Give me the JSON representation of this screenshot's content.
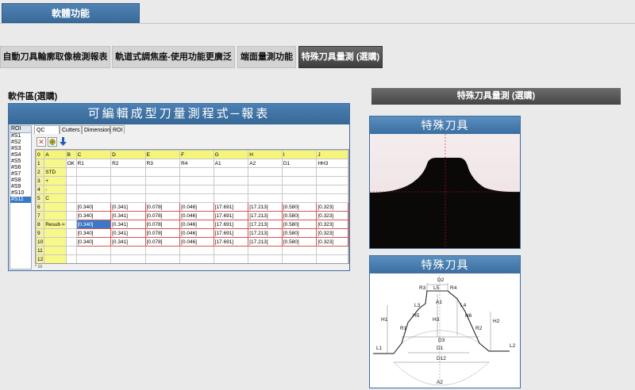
{
  "header": {
    "title": "軟體功能"
  },
  "feature_tabs": [
    {
      "label": "自動刀具輪廓取像檢測報表"
    },
    {
      "label": "軌道式調焦座-使用功能更廣泛"
    },
    {
      "label": "端面量測功能"
    },
    {
      "label": "特殊刀具量測 (選購)"
    }
  ],
  "software_section": {
    "label": "軟件區(選購)"
  },
  "app_window": {
    "title": "可編輯成型刀量測程式─報表",
    "roi_list": {
      "header": "ROI",
      "items": [
        "#S1",
        "#S2",
        "#S3",
        "#S4",
        "#S5",
        "#S6",
        "#S7",
        "#S8",
        "#S9",
        "#S10",
        "#S11"
      ],
      "selected": "#S11"
    },
    "subtabs": [
      "QC",
      "Cutters",
      "Dimension",
      "ROI"
    ],
    "toolbar": {
      "icons": [
        "close-icon",
        "refresh-icon",
        "download-arrow-icon"
      ]
    },
    "sheet": {
      "col_headers": [
        "0",
        "A",
        "B",
        "C",
        "D",
        "E",
        "F",
        "G",
        "H",
        "I",
        "J"
      ],
      "rows": [
        [
          "1",
          "",
          "OK",
          "R1",
          "R2",
          "R3",
          "R4",
          "A1",
          "A2",
          "D1",
          "HH3"
        ],
        [
          "2",
          "STD",
          "",
          "",
          "",
          "",
          "",
          "",
          "",
          "",
          ""
        ],
        [
          "3",
          "+",
          "",
          "",
          "",
          "",
          "",
          "",
          "",
          "",
          ""
        ],
        [
          "4",
          "-",
          "",
          "",
          "",
          "",
          "",
          "",
          "",
          "",
          ""
        ],
        [
          "5",
          "C",
          "",
          "",
          "",
          "",
          "",
          "",
          "",
          "",
          ""
        ],
        [
          "6",
          "",
          "",
          "[0.340]",
          "[0.341]",
          "[0.078]",
          "[0.046]",
          "[17.691]",
          "[17.213]",
          "[0.580]",
          "[0.323]"
        ],
        [
          "7",
          "",
          "",
          "[0.340]",
          "[0.341]",
          "[0.078]",
          "[0.046]",
          "[17.691]",
          "[17.213]",
          "[0.580]",
          "[0.323]"
        ],
        [
          "8",
          "Result->",
          "",
          "[0.340]",
          "[0.341]",
          "[0.078]",
          "[0.046]",
          "[17.691]",
          "[17.213]",
          "[0.580]",
          "[0.323]"
        ],
        [
          "9",
          "",
          "",
          "[0.340]",
          "[0.341]",
          "[0.078]",
          "[0.046]",
          "[17.691]",
          "[17.213]",
          "[0.580]",
          "[0.323]"
        ],
        [
          "10",
          "",
          "",
          "[0.340]",
          "[0.341]",
          "[0.078]",
          "[0.046]",
          "[17.691]",
          "[17.213]",
          "[0.580]",
          "[0.323]"
        ],
        [
          "11",
          "",
          "",
          "",
          "",
          "",
          "",
          "",
          "",
          "",
          ""
        ],
        [
          "12",
          "",
          "",
          "",
          "",
          "",
          "",
          "",
          "",
          "",
          ""
        ],
        [
          "13",
          "",
          "",
          "",
          "",
          "",
          "",
          "",
          "",
          "",
          ""
        ]
      ],
      "scroll_label": "* ⊟"
    }
  },
  "right_panel": {
    "header": "特殊刀具量測 (選購)",
    "photo_card": {
      "title": "特殊刀具"
    },
    "diagram_card": {
      "title": "特殊刀具",
      "labels": [
        "D2",
        "R3",
        "L5",
        "R4",
        "A1",
        "L3",
        "L4",
        "H5",
        "H6",
        "H1",
        "H3",
        "H2",
        "R1",
        "R2",
        "L1",
        "L2",
        "D3",
        "D1",
        "D12",
        "A2"
      ]
    }
  },
  "colors": {
    "header_blue": "#3a6a98",
    "active_tab": "#3e3e3e",
    "sheet_yellow": "#f5f57a",
    "value_border": "#d9534f",
    "selection": "#3a78c8"
  }
}
